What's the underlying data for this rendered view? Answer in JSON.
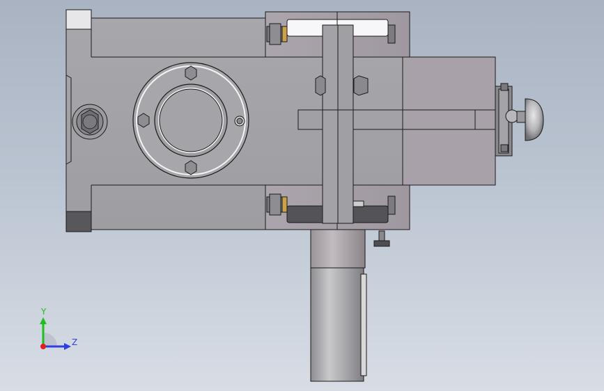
{
  "viewport": {
    "background_top": "#a9b3c2",
    "background_bottom": "#d8dde5"
  },
  "part_colors": {
    "body": "#a3a3a7",
    "plate": "#a59ea6",
    "slide": "#a7a0a8",
    "bolt": "#8a8a8e",
    "edge": "#1a1a1a"
  },
  "axes": {
    "y_label": "Y",
    "z_label": "Z",
    "y_color": "#1fbf1f",
    "z_color": "#2f3fe0",
    "x_color": "#e02020"
  }
}
